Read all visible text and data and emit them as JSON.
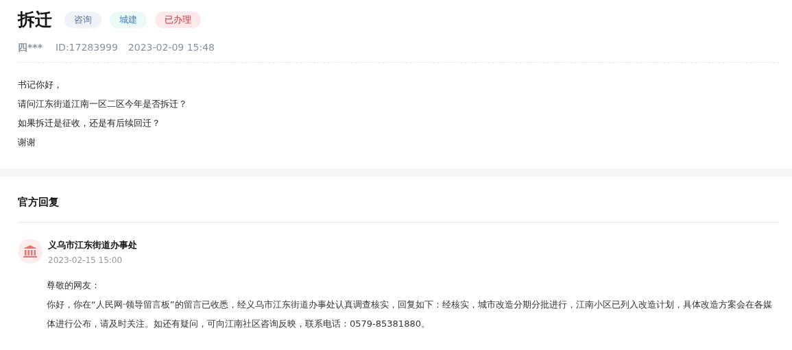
{
  "question": {
    "title": "拆迁",
    "tags": [
      {
        "label": "咨询",
        "kind": "type"
      },
      {
        "label": "城建",
        "kind": "field"
      },
      {
        "label": "已办理",
        "kind": "status"
      }
    ],
    "author": "四***",
    "id": "ID:17283999",
    "time": "2023-02-09 15:48",
    "lines": [
      "书记你好，",
      "请问江东街道江南一区二区今年是否拆迁？",
      "如果拆迁是征收，还是有后续回迁？",
      "谢谢"
    ]
  },
  "reply": {
    "heading": "官方回复",
    "department": "义乌市江东街道办事处",
    "time": "2023-02-15 15:00",
    "greeting": "尊敬的网友：",
    "body": "你好，你在“人民网·领导留言板”的留言已收悉，经义乌市江东街道办事处认真调查核实，回复如下：经核实，城市改造分期分批进行，江南小区已列入改造计划，具体改造方案会在各媒体进行公布，请及时关注。如还有疑问，可向江南社区咨询反映，联系电话：0579-85381880。"
  }
}
